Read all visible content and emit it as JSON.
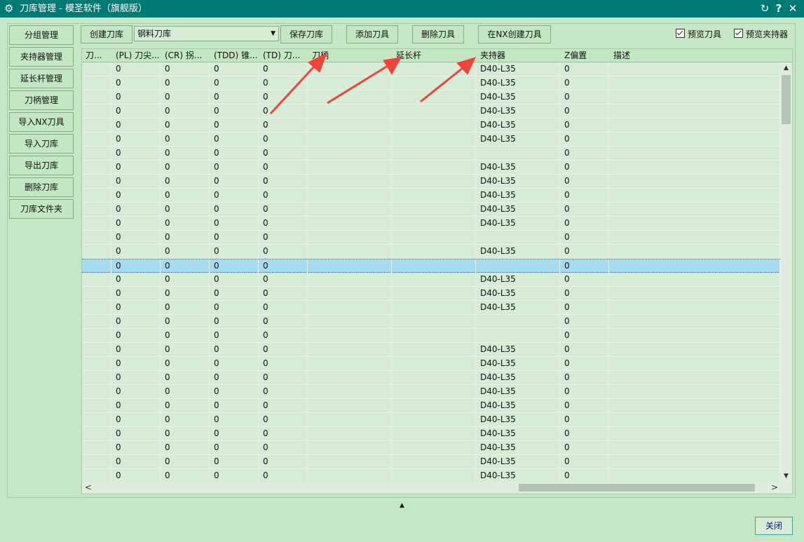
{
  "window": {
    "title": "刀库管理 - 模圣软件（旗舰版）",
    "gear_glyph": "⚙",
    "refresh_glyph": "↻",
    "help_glyph": "?",
    "close_glyph": "✕"
  },
  "sidebar": {
    "items": [
      "分组管理",
      "夹持器管理",
      "延长杆管理",
      "刀柄管理",
      "导入NX刀具",
      "导入刀库",
      "导出刀库",
      "删除刀库",
      "刀库文件夹"
    ]
  },
  "toolbar": {
    "create_library": "创建刀库",
    "library_select": "钢料刀库",
    "save_library": "保存刀库",
    "add_tool": "添加刀具",
    "delete_tool": "删除刀具",
    "create_in_nx": "在NX创建刀具",
    "preview_tool": "预览刀具",
    "preview_holder": "预览夹持器"
  },
  "table": {
    "columns": [
      "刀...",
      "(PL) 刀尖...",
      "(CR) 拐...",
      "(TDD) 锥...",
      "(TD) 刀...",
      "刀柄",
      "延长杆",
      "夹持器",
      "Z偏置",
      "描述"
    ],
    "rows": [
      [
        "",
        "0",
        "0",
        "0",
        "0",
        "",
        "",
        "D40-L35",
        "0",
        ""
      ],
      [
        "",
        "0",
        "0",
        "0",
        "0",
        "",
        "",
        "D40-L35",
        "0",
        ""
      ],
      [
        "",
        "0",
        "0",
        "0",
        "0",
        "",
        "",
        "D40-L35",
        "0",
        ""
      ],
      [
        "",
        "0",
        "0",
        "0",
        "0",
        "",
        "",
        "D40-L35",
        "0",
        ""
      ],
      [
        "",
        "0",
        "0",
        "0",
        "0",
        "",
        "",
        "D40-L35",
        "0",
        ""
      ],
      [
        "",
        "0",
        "0",
        "0",
        "0",
        "",
        "",
        "D40-L35",
        "0",
        ""
      ],
      [
        "",
        "0",
        "0",
        "0",
        "0",
        "",
        "",
        "",
        "0",
        ""
      ],
      [
        "",
        "0",
        "0",
        "0",
        "0",
        "",
        "",
        "D40-L35",
        "0",
        ""
      ],
      [
        "",
        "0",
        "0",
        "0",
        "0",
        "",
        "",
        "D40-L35",
        "0",
        ""
      ],
      [
        "",
        "0",
        "0",
        "0",
        "0",
        "",
        "",
        "D40-L35",
        "0",
        ""
      ],
      [
        "",
        "0",
        "0",
        "0",
        "0",
        "",
        "",
        "D40-L35",
        "0",
        ""
      ],
      [
        "",
        "0",
        "0",
        "0",
        "0",
        "",
        "",
        "D40-L35",
        "0",
        ""
      ],
      [
        "",
        "0",
        "0",
        "0",
        "0",
        "",
        "",
        "",
        "0",
        ""
      ],
      [
        "",
        "0",
        "0",
        "0",
        "0",
        "",
        "",
        "D40-L35",
        "0",
        ""
      ],
      [
        "",
        "0",
        "0",
        "0",
        "0",
        "",
        "",
        "",
        "0",
        ""
      ],
      [
        "",
        "0",
        "0",
        "0",
        "0",
        "",
        "",
        "D40-L35",
        "0",
        ""
      ],
      [
        "",
        "0",
        "0",
        "0",
        "0",
        "",
        "",
        "D40-L35",
        "0",
        ""
      ],
      [
        "",
        "0",
        "0",
        "0",
        "0",
        "",
        "",
        "D40-L35",
        "0",
        ""
      ],
      [
        "",
        "0",
        "0",
        "0",
        "0",
        "",
        "",
        "",
        "0",
        ""
      ],
      [
        "",
        "0",
        "0",
        "0",
        "0",
        "",
        "",
        "",
        "0",
        ""
      ],
      [
        "",
        "0",
        "0",
        "0",
        "0",
        "",
        "",
        "D40-L35",
        "0",
        ""
      ],
      [
        "",
        "0",
        "0",
        "0",
        "0",
        "",
        "",
        "D40-L35",
        "0",
        ""
      ],
      [
        "",
        "0",
        "0",
        "0",
        "0",
        "",
        "",
        "D40-L35",
        "0",
        ""
      ],
      [
        "",
        "0",
        "0",
        "0",
        "0",
        "",
        "",
        "D40-L35",
        "0",
        ""
      ],
      [
        "",
        "0",
        "0",
        "0",
        "0",
        "",
        "",
        "D40-L35",
        "0",
        ""
      ],
      [
        "",
        "0",
        "0",
        "0",
        "0",
        "",
        "",
        "D40-L35",
        "0",
        ""
      ],
      [
        "",
        "0",
        "0",
        "0",
        "0",
        "",
        "",
        "D40-L35",
        "0",
        ""
      ],
      [
        "",
        "0",
        "0",
        "0",
        "0",
        "",
        "",
        "D40-L35",
        "0",
        ""
      ],
      [
        "",
        "0",
        "0",
        "0",
        "0",
        "",
        "",
        "D40-L35",
        "0",
        ""
      ],
      [
        "",
        "0",
        "0",
        "0",
        "0",
        "",
        "",
        "D40-L35",
        "0",
        ""
      ]
    ],
    "selected_row": 14
  },
  "scrollbars": {
    "up_glyph": "▲",
    "down_glyph": "▼",
    "left_glyph": "<",
    "right_glyph": ">"
  },
  "footer": {
    "collapse_glyph": "▲",
    "close_button": "关闭"
  },
  "colors": {
    "titlebar": "#007a74",
    "background": "#c5e7c5",
    "grid": "#d6ecd6",
    "selection": "#a6dcef",
    "annotation_arrow": "#f0443a"
  }
}
